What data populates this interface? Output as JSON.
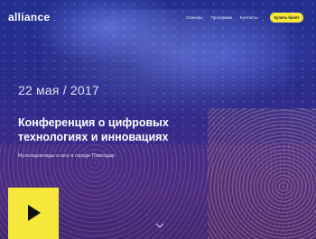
{
  "brand": {
    "logo_text": "alliance"
  },
  "nav": {
    "items": [
      {
        "label": "Спикеры"
      },
      {
        "label": "Программа"
      },
      {
        "label": "Контакты"
      }
    ],
    "cta_label": "Купить билет"
  },
  "hero": {
    "date": "22 мая / 2017",
    "headline": "Конференция о цифровых технологиях и инновациях",
    "subline": "Мультидоклады и шоу в городе Павлодар"
  },
  "colors": {
    "accent": "#f6e83a",
    "background_top": "#23308f",
    "background_bottom": "#4a2c86"
  },
  "icons": {
    "play": "play-icon",
    "scroll": "chevron-down-icon"
  }
}
